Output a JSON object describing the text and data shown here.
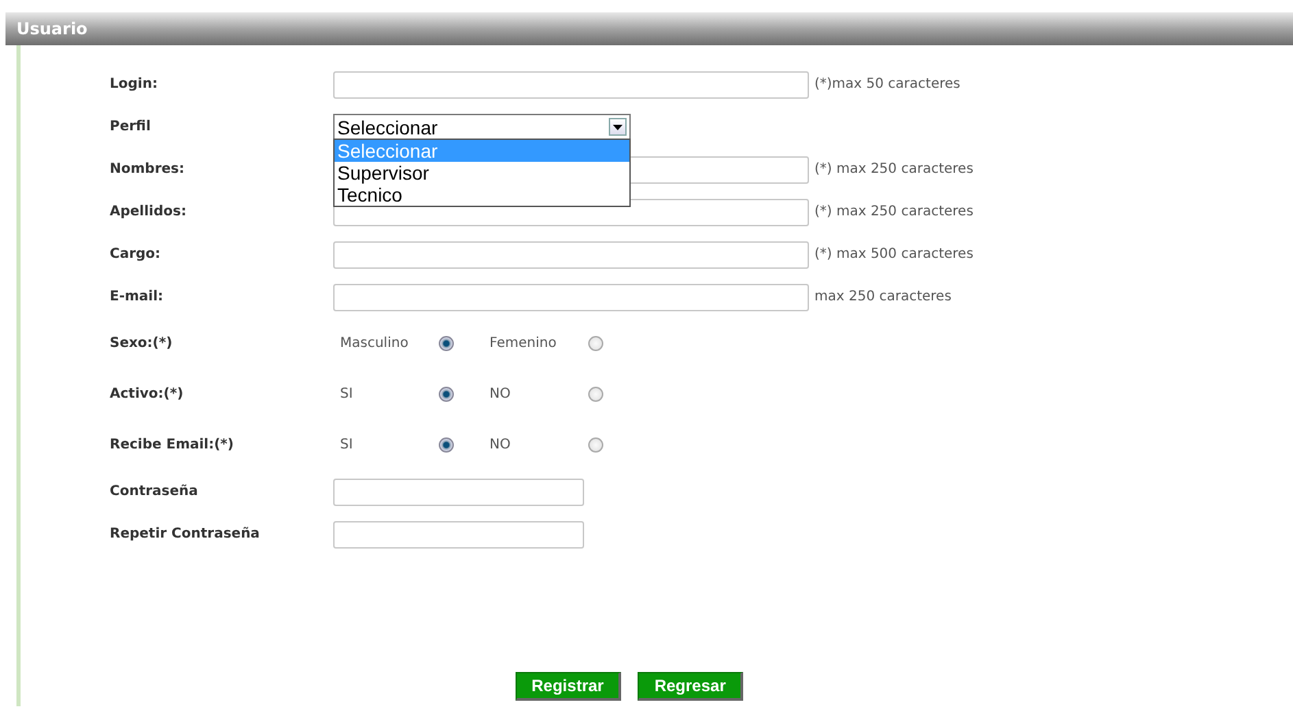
{
  "panel": {
    "title": "Usuario"
  },
  "fields": [
    {
      "kind": "text",
      "label": "Login:",
      "hint": "(*)max 50 caracteres"
    },
    {
      "kind": "select",
      "label": "Perfil",
      "value": "Seleccionar",
      "expanded": true,
      "options": [
        {
          "label": "Seleccionar",
          "selected": true
        },
        {
          "label": "Supervisor",
          "selected": false
        },
        {
          "label": "Tecnico",
          "selected": false
        }
      ]
    },
    {
      "kind": "text",
      "label": "Nombres:",
      "hint": "(*) max 250 caracteres"
    },
    {
      "kind": "text",
      "label": "Apellidos:",
      "hint": "(*) max 250 caracteres"
    },
    {
      "kind": "text",
      "label": "Cargo:",
      "hint": "(*) max 500 caracteres"
    },
    {
      "kind": "text",
      "label": "E-mail:",
      "hint": "max 250 caracteres"
    },
    {
      "kind": "radio",
      "label": "Sexo:(*)",
      "options": [
        {
          "label": "Masculino",
          "selected": true
        },
        {
          "label": "Femenino",
          "selected": false
        }
      ]
    },
    {
      "kind": "radio",
      "label": "Activo:(*)",
      "options": [
        {
          "label": "SI",
          "selected": true
        },
        {
          "label": "NO",
          "selected": false
        }
      ]
    },
    {
      "kind": "radio",
      "label": "Recibe Email:(*)",
      "options": [
        {
          "label": "SI",
          "selected": true
        },
        {
          "label": "NO",
          "selected": false
        }
      ]
    },
    {
      "kind": "password",
      "label": "Contraseña"
    },
    {
      "kind": "password",
      "label": "Repetir Contraseña"
    }
  ],
  "buttons": [
    "Registrar",
    "Regresar"
  ]
}
